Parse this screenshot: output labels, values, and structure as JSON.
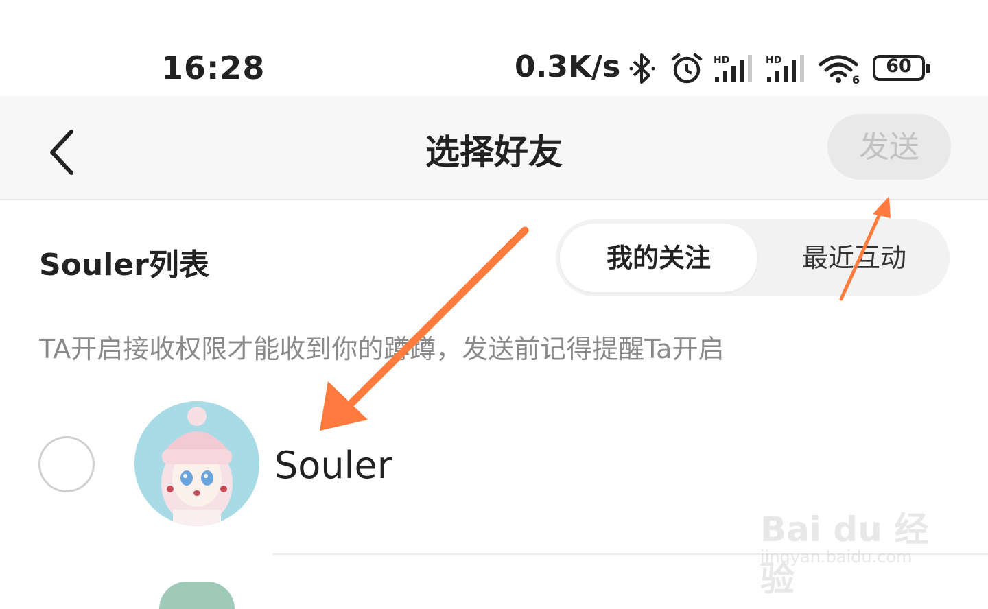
{
  "status_bar": {
    "time": "16:28",
    "net_speed": "0.3K/s",
    "battery_level": "60",
    "icons": [
      "bluetooth-icon",
      "alarm-icon",
      "hd-signal-icon",
      "hd-signal-icon",
      "wifi-icon",
      "battery-icon"
    ],
    "hd_label": "HD",
    "wifi_label": "6"
  },
  "nav": {
    "title": "选择好友",
    "send_label": "发送"
  },
  "section": {
    "title": "Souler列表",
    "tabs": [
      {
        "label": "我的关注",
        "active": true
      },
      {
        "label": "最近互动",
        "active": false
      }
    ]
  },
  "hint": "TA开启接收权限才能收到你的蹲蹲，发送前记得提醒Ta开启",
  "friends": [
    {
      "name": "Souler",
      "selected": false
    }
  ],
  "watermark": {
    "logo": "Bai du 经验",
    "url": "jingyan.baidu.com"
  },
  "colors": {
    "annotation_arrow": "#ff7a3d",
    "send_disabled_bg": "#e9e9e9",
    "send_disabled_text": "#c2c2c2"
  }
}
